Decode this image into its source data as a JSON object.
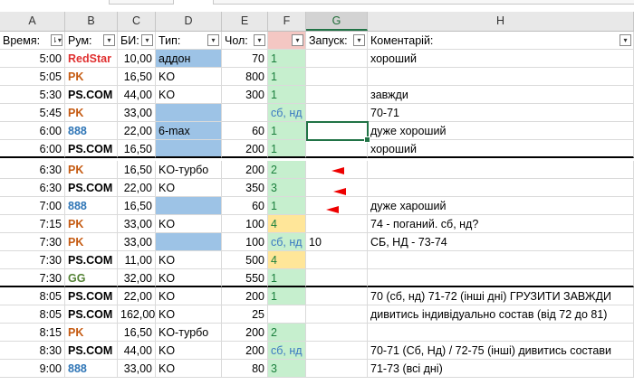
{
  "columns": [
    "A",
    "B",
    "C",
    "D",
    "E",
    "F",
    "G",
    "H"
  ],
  "selected_column": "G",
  "header": {
    "time": "Время:",
    "room": "Рум:",
    "buyin": "БИ:",
    "type": "Тип:",
    "players": "Чол:",
    "f": "",
    "start": "Запуск:",
    "comment": "Коментарій:"
  },
  "room_colors": {
    "RedStar": "#e03030",
    "PK": "#c55a11",
    "PS.COM": "#000000",
    "888": "#2e75b6",
    "GG": "#548235"
  },
  "rows": [
    {
      "time": "5:00",
      "room": "RedStar",
      "buyin": "10,00",
      "type": "аддон",
      "players": "70",
      "f": "1",
      "start": "",
      "comment": "хороший"
    },
    {
      "time": "5:05",
      "room": "PK",
      "buyin": "16,50",
      "type": "KO",
      "players": "800",
      "f": "1",
      "start": "",
      "comment": ""
    },
    {
      "time": "5:30",
      "room": "PS.COM",
      "buyin": "44,00",
      "type": "KO",
      "players": "300",
      "f": "1",
      "start": "",
      "comment": "завжди"
    },
    {
      "time": "5:45",
      "room": "PK",
      "buyin": "33,00",
      "type": "",
      "players": "",
      "f": "сб, нд",
      "start": "",
      "comment": "70-71"
    },
    {
      "time": "6:00",
      "room": "888",
      "buyin": "22,00",
      "type": "6-max",
      "players": "60",
      "f": "1",
      "start": "",
      "comment": "дуже хороший"
    },
    {
      "time": "6:00",
      "room": "PS.COM",
      "buyin": "16,50",
      "type": "",
      "players": "200",
      "f": "1",
      "start": "",
      "comment": "хороший"
    },
    {
      "time": "6:30",
      "room": "PK",
      "buyin": "16,50",
      "type": "KO-турбо",
      "players": "200",
      "f": "2",
      "start": "",
      "comment": ""
    },
    {
      "time": "6:30",
      "room": "PS.COM",
      "buyin": "22,00",
      "type": "KO",
      "players": "350",
      "f": "3",
      "start": "",
      "comment": ""
    },
    {
      "time": "7:00",
      "room": "888",
      "buyin": "16,50",
      "type": "",
      "players": "60",
      "f": "1",
      "start": "",
      "comment": "дуже хароший"
    },
    {
      "time": "7:15",
      "room": "PK",
      "buyin": "33,00",
      "type": "KO",
      "players": "100",
      "f": "4",
      "start": "",
      "comment": "74 - поганий. сб, нд?"
    },
    {
      "time": "7:30",
      "room": "PK",
      "buyin": "33,00",
      "type": "",
      "players": "100",
      "f": "сб, нд",
      "start": "10",
      "comment": "СБ, НД - 73-74"
    },
    {
      "time": "7:30",
      "room": "PS.COM",
      "buyin": "11,00",
      "type": "KO",
      "players": "500",
      "f": "4",
      "start": "",
      "comment": ""
    },
    {
      "time": "7:30",
      "room": "GG",
      "buyin": "32,00",
      "type": "KO",
      "players": "550",
      "f": "1",
      "start": "",
      "comment": ""
    },
    {
      "time": "8:05",
      "room": "PS.COM",
      "buyin": "22,00",
      "type": "KO",
      "players": "200",
      "f": "1",
      "start": "",
      "comment": "70 (сб, нд) 71-72 (інші дні) ГРУЗИТИ ЗАВЖДИ"
    },
    {
      "time": "8:05",
      "room": "PS.COM",
      "buyin": "162,00",
      "type": "KO",
      "players": "25",
      "f": "",
      "start": "",
      "comment": "дивитись індивідуально состав (від 72 до 81)"
    },
    {
      "time": "8:15",
      "room": "PK",
      "buyin": "16,50",
      "type": "KO-турбо",
      "players": "200",
      "f": "2",
      "start": "",
      "comment": ""
    },
    {
      "time": "8:30",
      "room": "PS.COM",
      "buyin": "44,00",
      "type": "KO",
      "players": "200",
      "f": "сб, нд",
      "start": "",
      "comment": "70-71 (Сб, Нд) / 72-75 (інші) дивитись состави"
    },
    {
      "time": "9:00",
      "room": "888",
      "buyin": "33,00",
      "type": "KO",
      "players": "80",
      "f": "3",
      "start": "",
      "comment": "71-73 (всі дні)"
    }
  ]
}
